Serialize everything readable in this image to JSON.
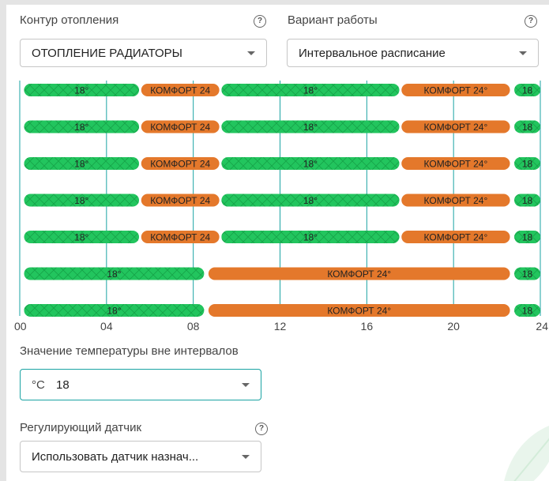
{
  "heating_circuit": {
    "label": "Контур отопления",
    "value": "ОТОПЛЕНИЕ РАДИАТОРЫ"
  },
  "work_mode": {
    "label": "Вариант работы",
    "value": "Интервальное расписание"
  },
  "help_glyph": "?",
  "schedule": {
    "axis_ticks": [
      "00",
      "04",
      "08",
      "12",
      "16",
      "20",
      "24"
    ],
    "colors": {
      "base": "#22c55e",
      "comfort": "#e4782b",
      "grid": "#1aa3a3"
    },
    "rows": [
      [
        {
          "start": 0.2,
          "end": 5.5,
          "type": "base",
          "label": "18°"
        },
        {
          "start": 5.6,
          "end": 9.2,
          "type": "comfort",
          "label": "КОМФОРТ 24"
        },
        {
          "start": 9.3,
          "end": 17.5,
          "type": "base",
          "label": "18°"
        },
        {
          "start": 17.6,
          "end": 22.6,
          "type": "comfort",
          "label": "КОМФОРТ 24°"
        },
        {
          "start": 22.8,
          "end": 24.0,
          "type": "base",
          "label": "18"
        }
      ],
      [
        {
          "start": 0.2,
          "end": 5.5,
          "type": "base",
          "label": "18°"
        },
        {
          "start": 5.6,
          "end": 9.2,
          "type": "comfort",
          "label": "КОМФОРТ 24"
        },
        {
          "start": 9.3,
          "end": 17.5,
          "type": "base",
          "label": "18°"
        },
        {
          "start": 17.6,
          "end": 22.6,
          "type": "comfort",
          "label": "КОМФОРТ 24°"
        },
        {
          "start": 22.8,
          "end": 24.0,
          "type": "base",
          "label": "18"
        }
      ],
      [
        {
          "start": 0.2,
          "end": 5.5,
          "type": "base",
          "label": "18°"
        },
        {
          "start": 5.6,
          "end": 9.2,
          "type": "comfort",
          "label": "КОМФОРТ 24"
        },
        {
          "start": 9.3,
          "end": 17.5,
          "type": "base",
          "label": "18°"
        },
        {
          "start": 17.6,
          "end": 22.6,
          "type": "comfort",
          "label": "КОМФОРТ 24°"
        },
        {
          "start": 22.8,
          "end": 24.0,
          "type": "base",
          "label": "18"
        }
      ],
      [
        {
          "start": 0.2,
          "end": 5.5,
          "type": "base",
          "label": "18°"
        },
        {
          "start": 5.6,
          "end": 9.2,
          "type": "comfort",
          "label": "КОМФОРТ 24"
        },
        {
          "start": 9.3,
          "end": 17.5,
          "type": "base",
          "label": "18°"
        },
        {
          "start": 17.6,
          "end": 22.6,
          "type": "comfort",
          "label": "КОМФОРТ 24°"
        },
        {
          "start": 22.8,
          "end": 24.0,
          "type": "base",
          "label": "18"
        }
      ],
      [
        {
          "start": 0.2,
          "end": 5.5,
          "type": "base",
          "label": "18°"
        },
        {
          "start": 5.6,
          "end": 9.2,
          "type": "comfort",
          "label": "КОМФОРТ 24"
        },
        {
          "start": 9.3,
          "end": 17.5,
          "type": "base",
          "label": "18°"
        },
        {
          "start": 17.6,
          "end": 22.6,
          "type": "comfort",
          "label": "КОМФОРТ 24°"
        },
        {
          "start": 22.8,
          "end": 24.0,
          "type": "base",
          "label": "18"
        }
      ],
      [
        {
          "start": 0.2,
          "end": 8.5,
          "type": "base",
          "label": "18°"
        },
        {
          "start": 8.7,
          "end": 22.6,
          "type": "comfort",
          "label": "КОМФОРТ 24°"
        },
        {
          "start": 22.8,
          "end": 24.0,
          "type": "base",
          "label": "18"
        }
      ],
      [
        {
          "start": 0.2,
          "end": 8.5,
          "type": "base",
          "label": "18°"
        },
        {
          "start": 8.7,
          "end": 22.6,
          "type": "comfort",
          "label": "КОМФОРТ 24°"
        },
        {
          "start": 22.8,
          "end": 24.0,
          "type": "base",
          "label": "18"
        }
      ]
    ]
  },
  "outside_temp": {
    "label": "Значение температуры вне интервалов",
    "unit": "°C",
    "value": "18"
  },
  "sensor": {
    "label": "Регулирующий датчик",
    "value": "Использовать датчик назнач..."
  }
}
